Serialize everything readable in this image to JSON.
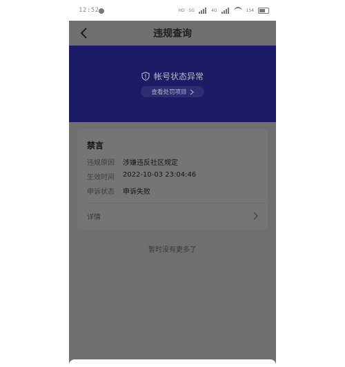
{
  "status_bar": {
    "time": "12:52",
    "indicators": [
      "HD",
      "5G",
      "4G"
    ],
    "battery": "154"
  },
  "nav": {
    "title": "违规查询",
    "back_icon": "back-chevron-icon"
  },
  "banner": {
    "status_text": "帐号状态异常",
    "link_text": "查看处罚项目",
    "icon": "shield-alert-icon",
    "color": "#1c1c66"
  },
  "violation_card": {
    "title": "禁言",
    "rows": [
      {
        "label": "违规原因",
        "value": "涉嫌违反社区规定"
      },
      {
        "label": "生效时间",
        "value": "2022-10-03 23:04:46"
      },
      {
        "label": "申诉状态",
        "value": "申诉失败"
      }
    ],
    "detail_label": "详情"
  },
  "empty_note": "暂时没有更多了"
}
